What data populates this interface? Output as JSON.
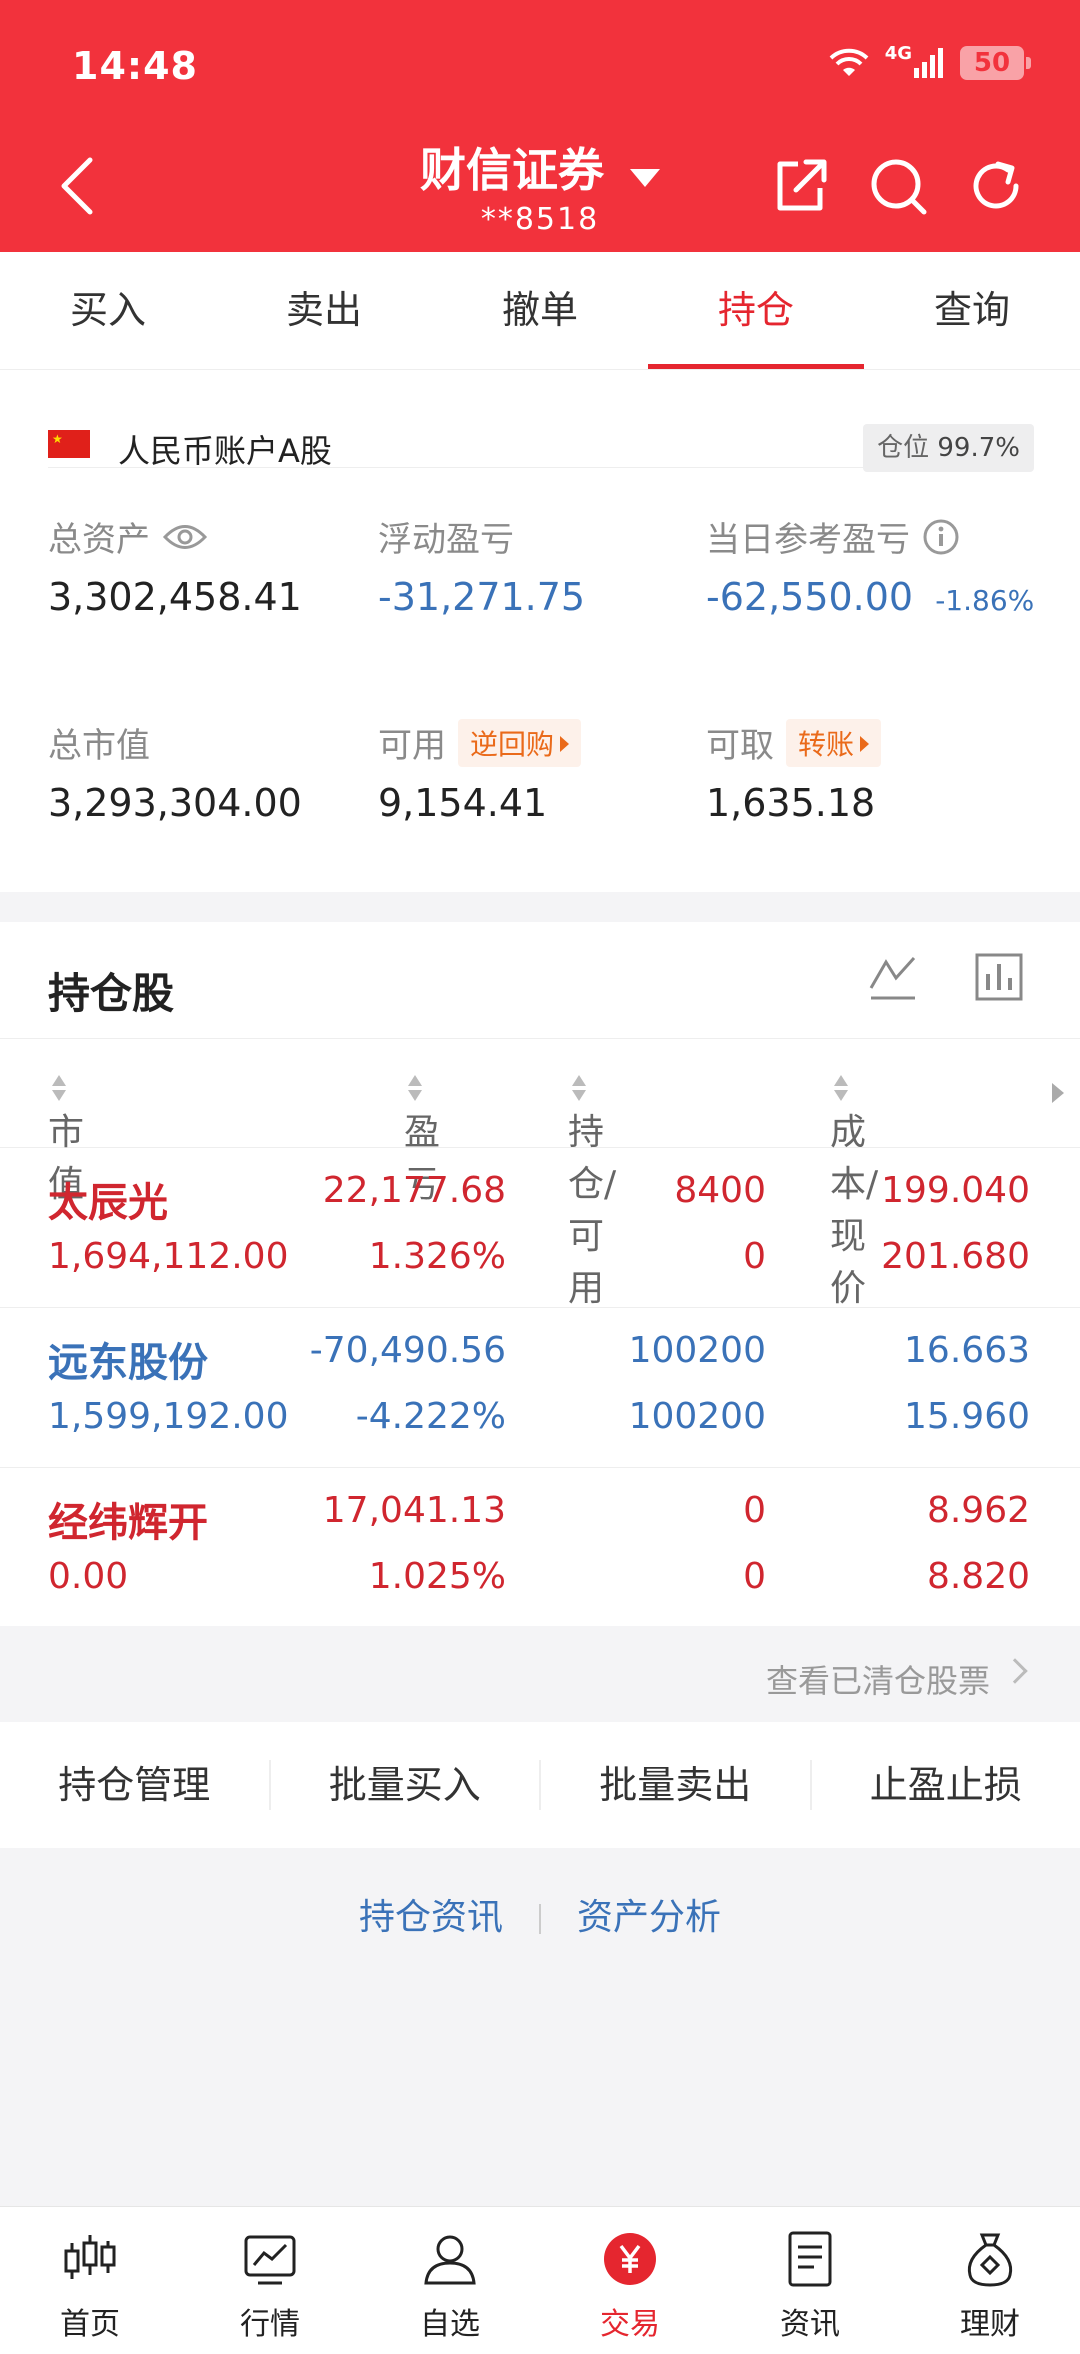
{
  "status_bar": {
    "time": "14:48",
    "network": "4G",
    "battery": "50"
  },
  "header": {
    "title": "财信证券",
    "account": "**8518"
  },
  "tabs": [
    {
      "label": "买入",
      "active": false
    },
    {
      "label": "卖出",
      "active": false
    },
    {
      "label": "撤单",
      "active": false
    },
    {
      "label": "持仓",
      "active": true
    },
    {
      "label": "查询",
      "active": false
    }
  ],
  "account": {
    "name": "人民币账户A股",
    "position_label": "仓位",
    "position_value": "99.7%",
    "total_assets_label": "总资产",
    "total_assets": "3,302,458.41",
    "floating_pl_label": "浮动盈亏",
    "floating_pl": "-31,271.75",
    "daily_pl_label": "当日参考盈亏",
    "daily_pl": "-62,550.00",
    "daily_pl_pct": "-1.86%",
    "market_value_label": "总市值",
    "market_value": "3,293,304.00",
    "available_label": "可用",
    "available_tag": "逆回购",
    "available": "9,154.41",
    "withdrawable_label": "可取",
    "withdrawable_tag": "转账",
    "withdrawable": "1,635.18"
  },
  "holdings": {
    "title": "持仓股",
    "columns": [
      "市值",
      "盈亏",
      "持仓/可用",
      "成本/现价"
    ],
    "rows": [
      {
        "name": "太辰光",
        "market_value": "1,694,112.00",
        "pl": "22,177.68",
        "pl_pct": "1.326%",
        "hold": "8400",
        "avail": "0",
        "cost": "199.040",
        "price": "201.680",
        "trend": "up"
      },
      {
        "name": "远东股份",
        "market_value": "1,599,192.00",
        "pl": "-70,490.56",
        "pl_pct": "-4.222%",
        "hold": "100200",
        "avail": "100200",
        "cost": "16.663",
        "price": "15.960",
        "trend": "down"
      },
      {
        "name": "经纬辉开",
        "market_value": "0.00",
        "pl": "17,041.13",
        "pl_pct": "1.025%",
        "hold": "0",
        "avail": "0",
        "cost": "8.962",
        "price": "8.820",
        "trend": "up"
      }
    ],
    "cleared_link": "查看已清仓股票"
  },
  "actions": [
    "持仓管理",
    "批量买入",
    "批量卖出",
    "止盈止损"
  ],
  "links": [
    "持仓资讯",
    "资产分析"
  ],
  "bottom_nav": [
    {
      "label": "首页",
      "icon": "candlestick-icon",
      "active": false
    },
    {
      "label": "行情",
      "icon": "chart-icon",
      "active": false
    },
    {
      "label": "自选",
      "icon": "user-icon",
      "active": false
    },
    {
      "label": "交易",
      "icon": "yen-icon",
      "active": true
    },
    {
      "label": "资讯",
      "icon": "news-icon",
      "active": false
    },
    {
      "label": "理财",
      "icon": "money-bag-icon",
      "active": false
    }
  ],
  "colors": {
    "brand_red": "#f2323c",
    "up": "#d0262f",
    "down": "#3a72b8",
    "tag_orange": "#ea6a1a"
  }
}
